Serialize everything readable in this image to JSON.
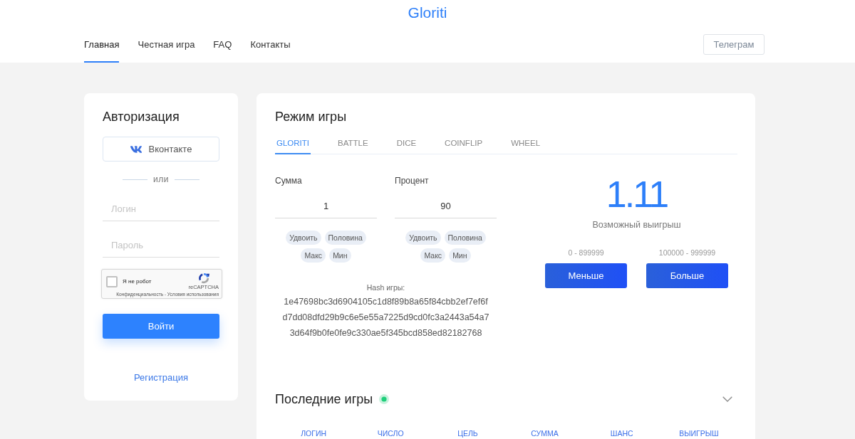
{
  "logo": "Gloriti",
  "nav": [
    {
      "label": "Главная",
      "selected": true
    },
    {
      "label": "Честная игра",
      "selected": false
    },
    {
      "label": "FAQ",
      "selected": false
    },
    {
      "label": "Контакты",
      "selected": false
    }
  ],
  "header_button": "Телеграм",
  "auth": {
    "title": "Авторизация",
    "vk_button": "Вконтакте",
    "divider": "или",
    "login": {
      "placeholder": "Логин"
    },
    "password": {
      "placeholder": "Пароль"
    },
    "captcha": {
      "label": "Я не робот",
      "checked": false,
      "brand": "reCAPTCHA",
      "links": "Конфиденциальность - Условия использования"
    },
    "submit": "Войти",
    "register": "Регистрация"
  },
  "game": {
    "title": "Режим игры",
    "tabs": [
      {
        "label": "GLORITI",
        "selected": true
      },
      {
        "label": "BATTLE",
        "selected": false
      },
      {
        "label": "DICE",
        "selected": false
      },
      {
        "label": "COINFLIP",
        "selected": false
      },
      {
        "label": "WHEEL",
        "selected": false
      }
    ],
    "fields": [
      {
        "label": "Сумма",
        "value": "1",
        "chips": [
          "Удвоить",
          "Половина",
          "Макс",
          "Мин"
        ]
      },
      {
        "label": "Процент",
        "value": "90",
        "chips": [
          "Удвоить",
          "Половина",
          "Макс",
          "Мин"
        ]
      }
    ],
    "hash": {
      "label": "Hash игры:",
      "lines": [
        "1e47698bc3d6904105c1d8f89b8a65f84cbb2ef7ef6f",
        "d7dd08dfd29b9c6e5e55a7225d9cd0fc3a2443a54a7",
        "3d64f9b0fe0fe9c330ae5f345bcd858ed82182768"
      ]
    },
    "multiplier": "1.11",
    "multiplier_caption": "Возможный выигрыш",
    "bets": [
      {
        "range": "0 - 899999",
        "button": "Меньше"
      },
      {
        "range": "100000 - 999999",
        "button": "Больше"
      }
    ]
  },
  "last_games": {
    "title": "Последние игры",
    "live": true,
    "columns": [
      "ЛОГИН",
      "ЧИСЛО",
      "ЦЕЛЬ",
      "СУММА",
      "ШАНС",
      "ВЫИГРЫШ"
    ]
  }
}
